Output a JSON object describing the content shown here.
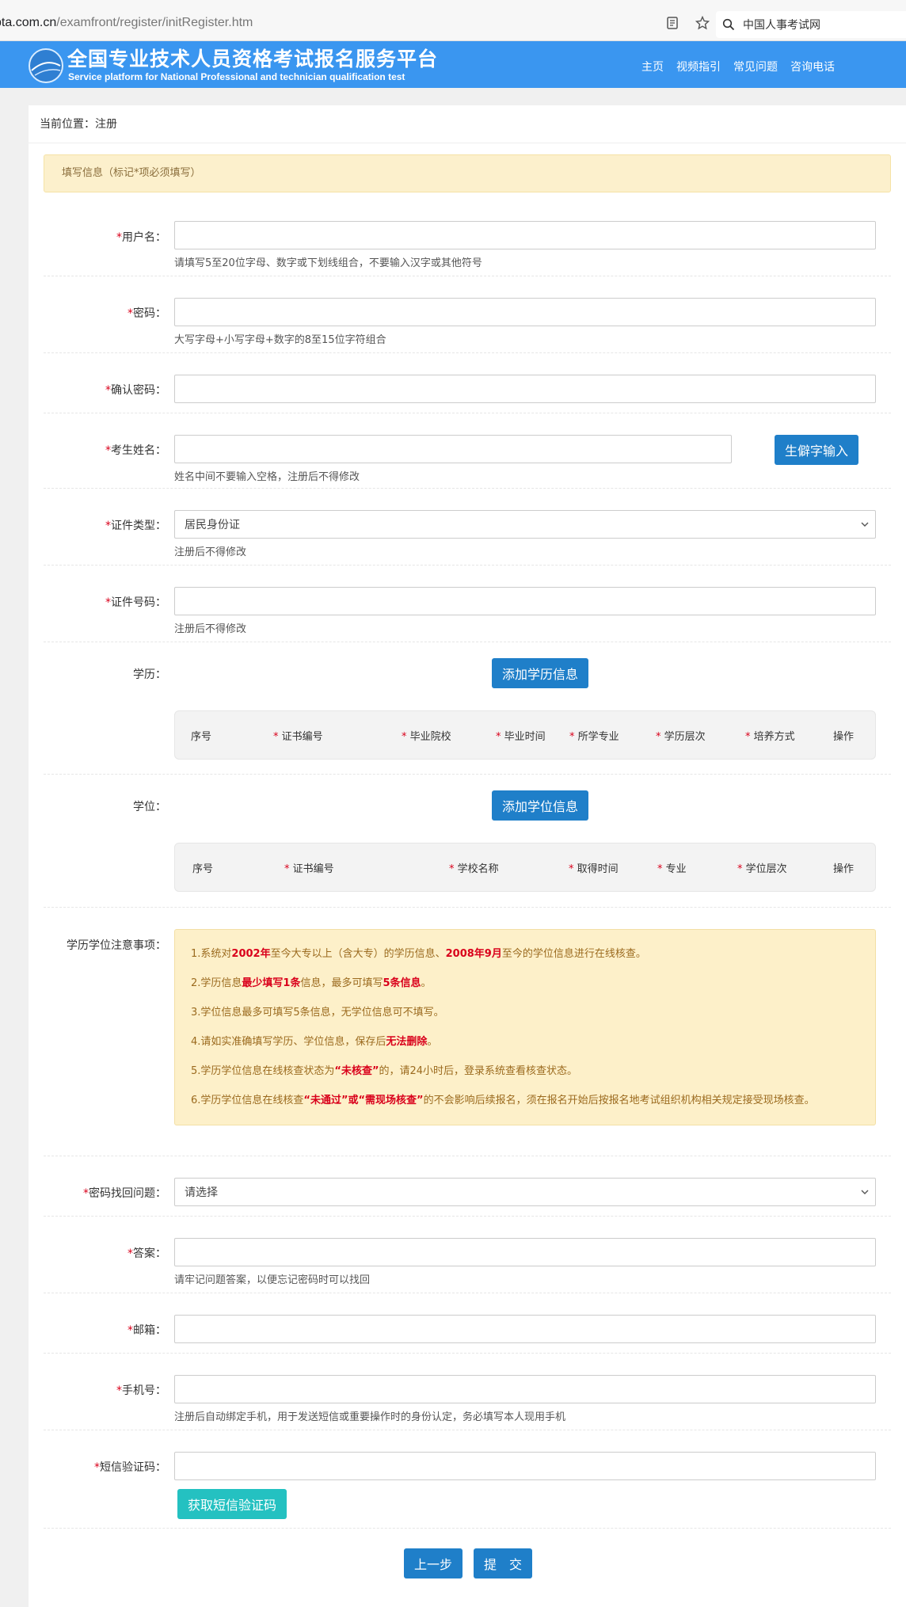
{
  "browser": {
    "url_host": "pta.com.cn",
    "url_path": "/examfront/register/initRegister.htm",
    "search_text": "中国人事考试网"
  },
  "header": {
    "title": "全国专业技术人员资格考试报名服务平台",
    "subtitle": "Service platform for National Professional and technician qualification test",
    "nav": [
      "主页",
      "视频指引",
      "常见问题",
      "咨询电话"
    ]
  },
  "breadcrumb": "当前位置：注册",
  "notice": "填写信息（标记*项必须填写）",
  "form": {
    "username": {
      "label": "用户名：",
      "help": "请填写5至20位字母、数字或下划线组合，不要输入汉字或其他符号",
      "value": ""
    },
    "password": {
      "label": "密码：",
      "help": "大写字母+小写字母+数字的8至15位字符组合",
      "value": ""
    },
    "confirm_password": {
      "label": "确认密码：",
      "value": ""
    },
    "name": {
      "label": "考生姓名：",
      "help": "姓名中间不要输入空格，注册后不得修改",
      "button": "生僻字输入",
      "value": ""
    },
    "id_type": {
      "label": "证件类型：",
      "selected": "居民身份证",
      "help": "注册后不得修改"
    },
    "id_number": {
      "label": "证件号码：",
      "help": "注册后不得修改",
      "value": ""
    },
    "education": {
      "label": "学历：",
      "button": "添加学历信息",
      "columns": [
        "序号",
        "证书编号",
        "毕业院校",
        "毕业时间",
        "所学专业",
        "学历层次",
        "培养方式",
        "操作"
      ]
    },
    "degree": {
      "label": "学位：",
      "button": "添加学位信息",
      "columns": [
        "序号",
        "证书编号",
        "学校名称",
        "取得时间",
        "专业",
        "学位层次",
        "操作"
      ]
    },
    "notes": {
      "label": "学历学位注意事项：",
      "items": [
        [
          "1.系统对",
          "2002年",
          "至今大专以上（含大专）的学历信息、",
          "2008年9月",
          "至今的学位信息进行在线核查。"
        ],
        [
          "2.学历信息",
          "最少填写1条",
          "信息，最多可填写",
          "5条信息",
          "。"
        ],
        [
          "3.学位信息最多可填写5条信息，无学位信息可不填写。"
        ],
        [
          "4.请如实准确填写学历、学位信息，保存后",
          "无法删除",
          "。"
        ],
        [
          "5.学历学位信息在线核查状态为",
          "“未核查”",
          "的，请24小时后，登录系统查看核查状态。"
        ],
        [
          "6.学历学位信息在线核查",
          "“未通过”或“需现场核查”",
          "的不会影响后续报名，须在报名开始后按报名地考试组织机构相关规定接受现场核查。"
        ]
      ]
    },
    "security_question": {
      "label": "密码找回问题：",
      "selected": "请选择"
    },
    "answer": {
      "label": "答案：",
      "help": "请牢记问题答案，以便忘记密码时可以找回",
      "value": ""
    },
    "email": {
      "label": "邮箱：",
      "value": ""
    },
    "phone": {
      "label": "手机号：",
      "help": "注册后自动绑定手机，用于发送短信或重要操作时的身份认定，务必填写本人现用手机",
      "value": ""
    },
    "sms_code": {
      "label": "短信验证码：",
      "button": "获取短信验证码",
      "value": ""
    }
  },
  "actions": {
    "prev": "上一步",
    "submit": "提　交"
  },
  "colors": {
    "header_bg": "#3a96f0",
    "button_blue": "#1f7fc9",
    "button_green": "#24c1c1",
    "required": "#d9001b",
    "notice_bg": "#fcf0cc"
  }
}
